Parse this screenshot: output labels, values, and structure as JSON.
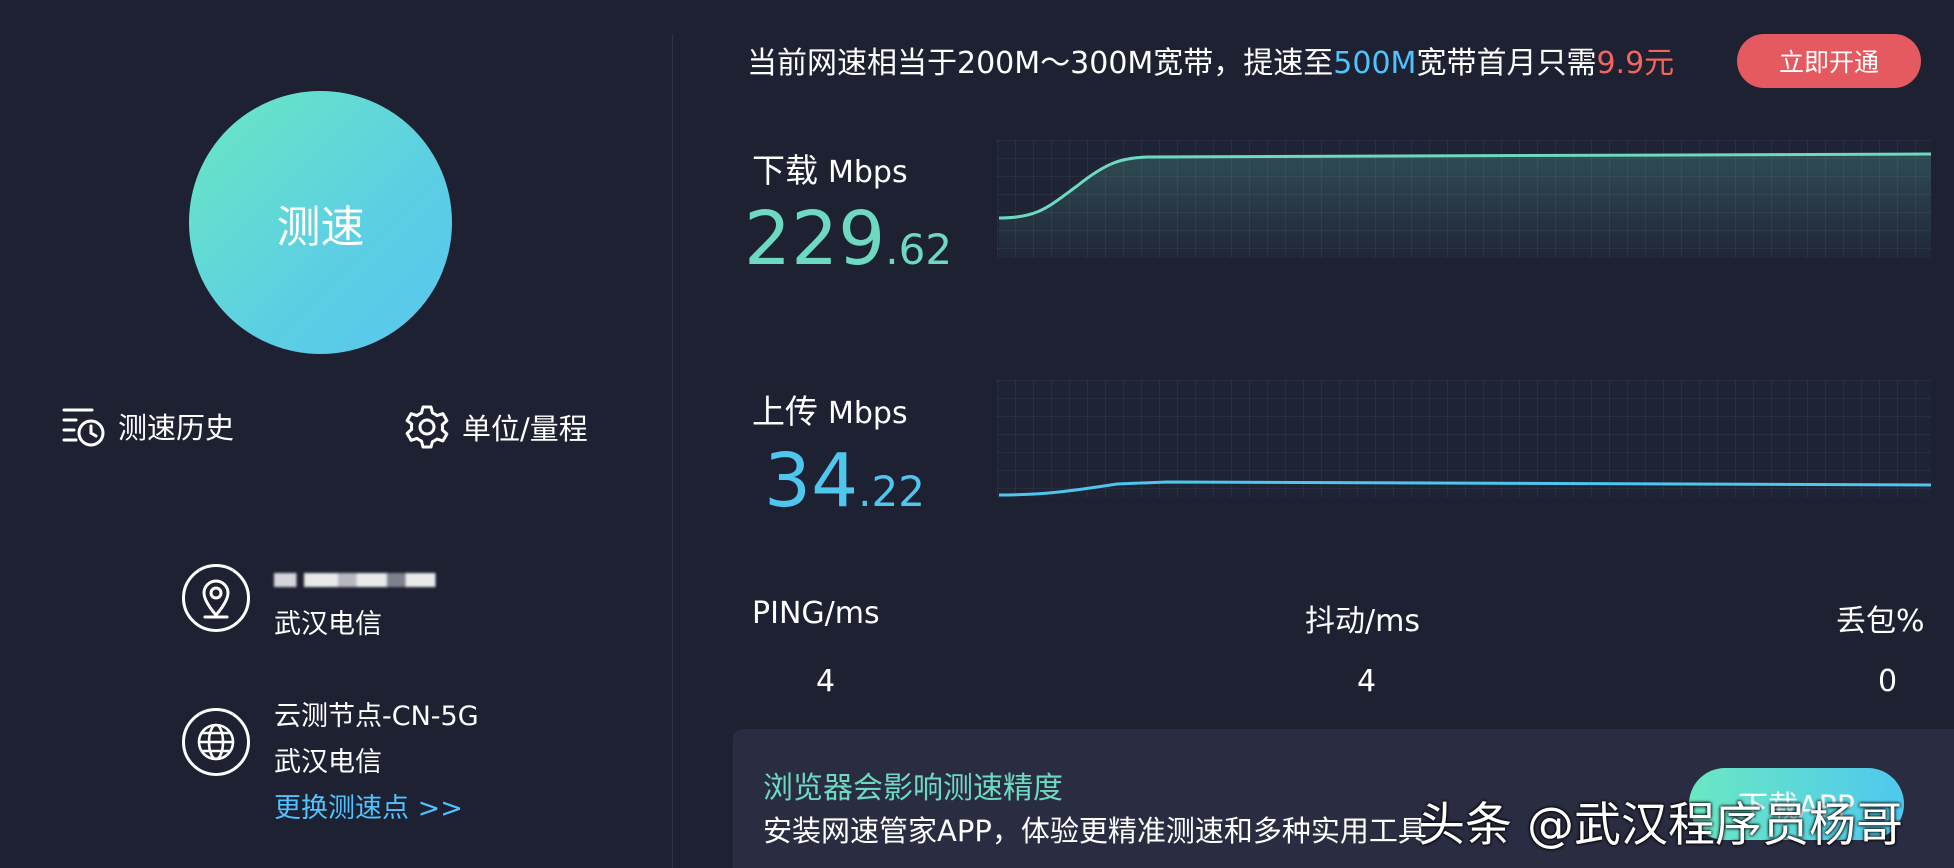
{
  "left_panel": {
    "start_button_label": "测速",
    "history_label": "测速历史",
    "settings_label": "单位/量程",
    "ip_icon": "location-pin-icon",
    "isp": "武汉电信",
    "node_icon": "globe-icon",
    "node_name": "云测节点-CN-5G",
    "node_isp": "武汉电信",
    "change_node_label": "更换测速点 >>"
  },
  "promo": {
    "prefix": "当前网速相当于200M～300M宽带，提速至",
    "highlight_speed": "500M",
    "middle": "宽带首月只需",
    "highlight_price": "9.9元",
    "button_label": "立即开通"
  },
  "download": {
    "label": "下载",
    "unit": "Mbps",
    "value_int": "229",
    "value_dec": ".62",
    "color": "#6ed9c1"
  },
  "upload": {
    "label": "上传",
    "unit": "Mbps",
    "value_int": "34",
    "value_dec": ".22",
    "color": "#4ec6ee"
  },
  "stats": {
    "ping_label": "PING/ms",
    "ping_value": "4",
    "jitter_label": "抖动/ms",
    "jitter_value": "4",
    "loss_label": "丢包%",
    "loss_value": "0"
  },
  "notice": {
    "title": "浏览器会影响测速精度",
    "body": "安装网速管家APP，体验更精准测速和多种实用工具",
    "button_label": "下载APP"
  },
  "watermark": "头条 @武汉程序员杨哥",
  "colors": {
    "background": "#1e2132",
    "accent_green": "#6ed9c1",
    "accent_cyan": "#4ec6ee",
    "accent_blue": "#4fc3ff",
    "accent_red": "#e45a60"
  }
}
